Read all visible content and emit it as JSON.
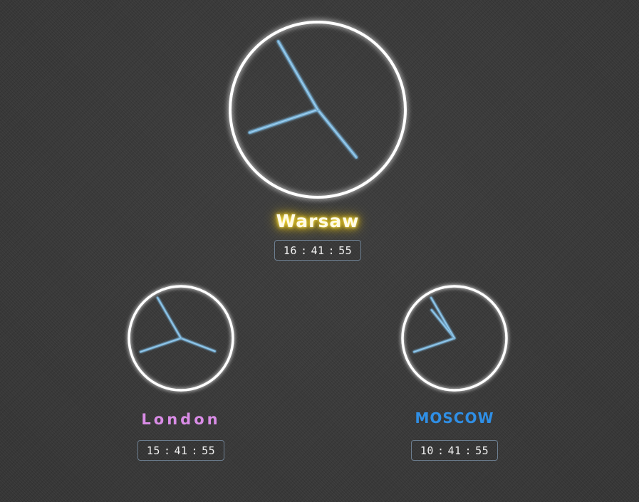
{
  "clocks": [
    {
      "id": "warsaw",
      "city": "Warsaw",
      "time": {
        "h": "16",
        "m": "41",
        "s": "55"
      },
      "hands": {
        "hour": 16.7,
        "minute": 41.9,
        "second": 55
      },
      "city_color": "#fffbe6",
      "glow_color": "#ffd300"
    },
    {
      "id": "london",
      "city": "London",
      "time": {
        "h": "15",
        "m": "41",
        "s": "55"
      },
      "hands": {
        "hour": 15.7,
        "minute": 41.9,
        "second": 55
      },
      "city_color": "#d98ce6"
    },
    {
      "id": "moscow",
      "city": "MOSCOW",
      "time": {
        "h": "10",
        "m": "41",
        "s": "55"
      },
      "hands": {
        "hour": 10.7,
        "minute": 41.9,
        "second": 55
      },
      "city_color": "#2f8fe6"
    }
  ],
  "time_separator": ":"
}
